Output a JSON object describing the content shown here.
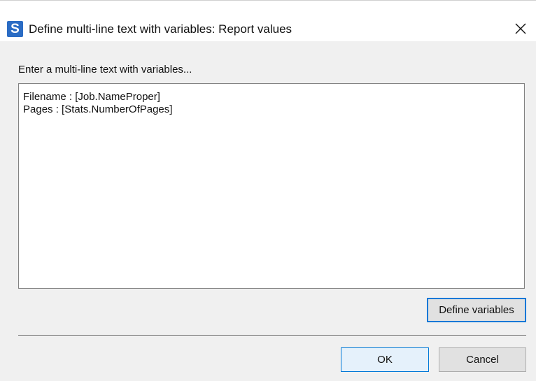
{
  "window": {
    "app_icon_letter": "S",
    "title": "Define multi-line text with variables: Report values"
  },
  "dialog": {
    "prompt": "Enter a multi-line text with variables...",
    "text_lines": [
      "Filename : [Job.NameProper]",
      "Pages : [Stats.NumberOfPages]"
    ],
    "define_variables_label": "Define variables",
    "ok_label": "OK",
    "cancel_label": "Cancel"
  },
  "colors": {
    "app_icon": "#2b6cc4",
    "dialog_background": "#f0f0f0",
    "focus_border": "#0078d7"
  },
  "icons": {
    "close": "close-icon"
  }
}
